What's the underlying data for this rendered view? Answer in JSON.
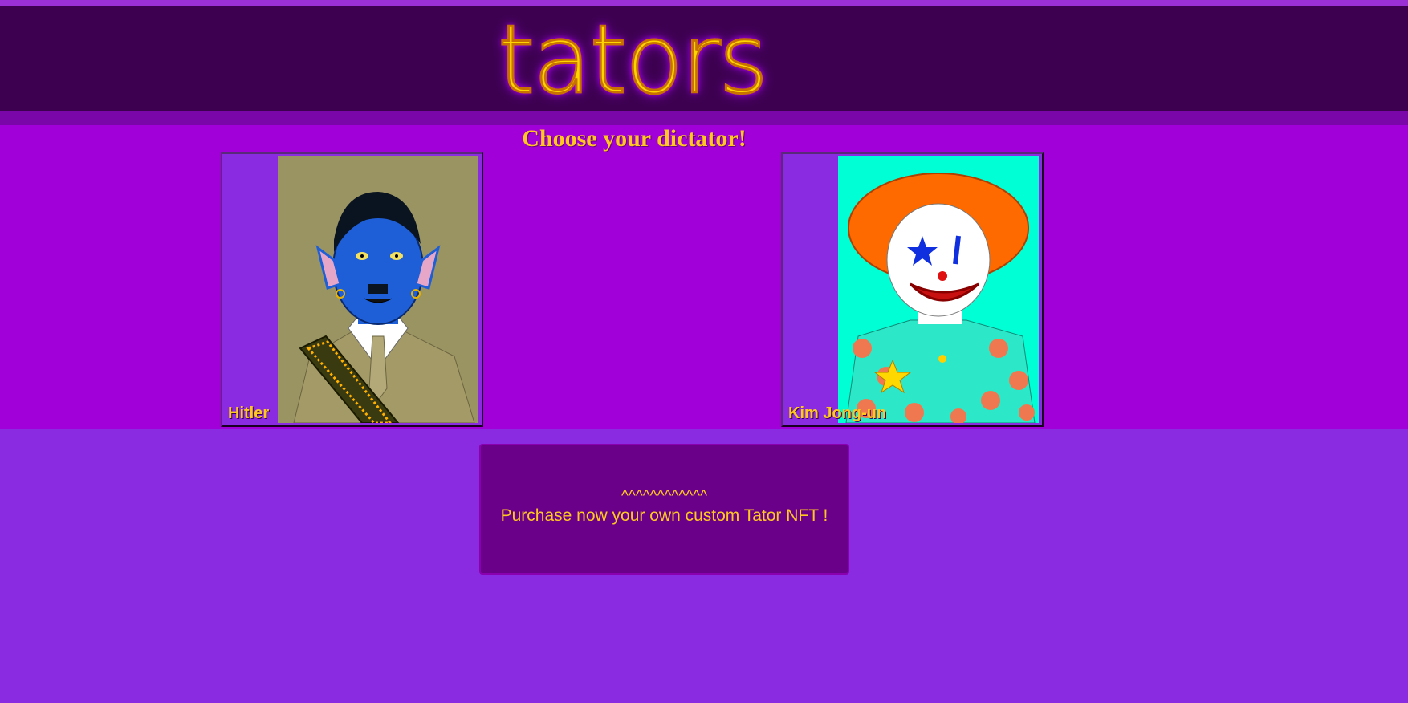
{
  "header": {
    "logo_text": "tators"
  },
  "main": {
    "title": "Choose your dictator!",
    "cards": [
      {
        "name": "Hitler",
        "portrait_bg": "#9a9463"
      },
      {
        "name": "Kim Jong-un",
        "portrait_bg": "#00ffd5"
      }
    ]
  },
  "purchase": {
    "carets": "^^^^^^^^^^^^",
    "message": "Purchase now your own custom Tator NFT !"
  },
  "colors": {
    "page_bg": "#8a2be2",
    "header_bg": "#3d0050",
    "main_bg": "#a200d9",
    "accent_text": "#ffc820",
    "purchase_bg": "#6a008a"
  }
}
